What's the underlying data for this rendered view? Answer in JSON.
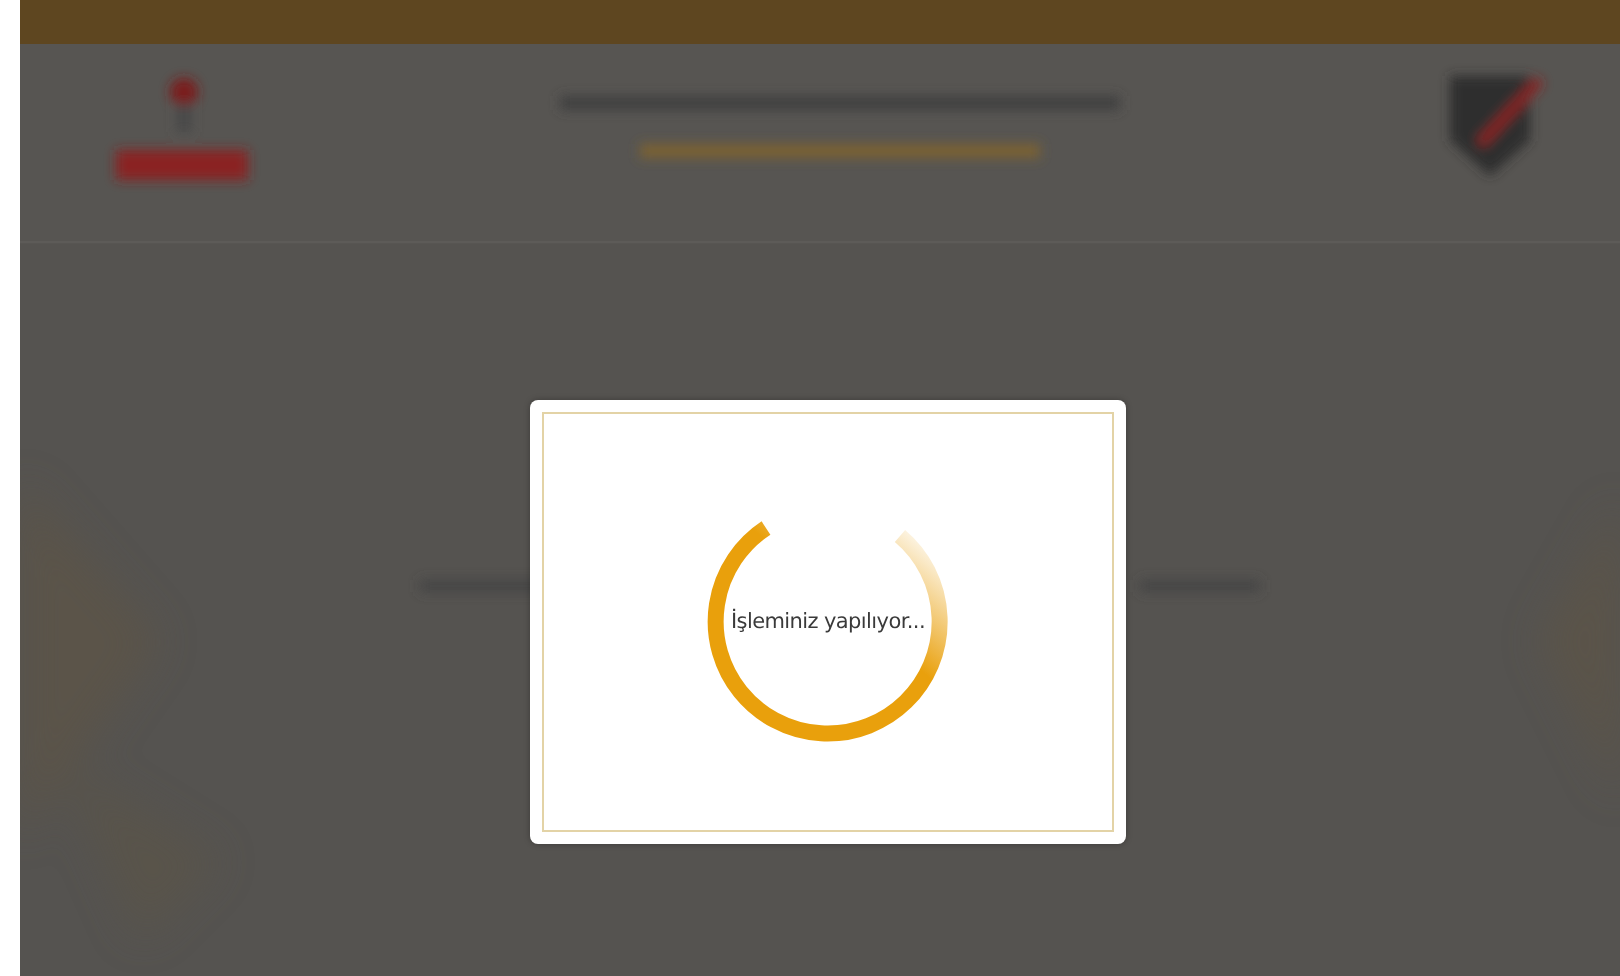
{
  "dialog": {
    "message": "İşleminiz yapılıyor..."
  }
}
